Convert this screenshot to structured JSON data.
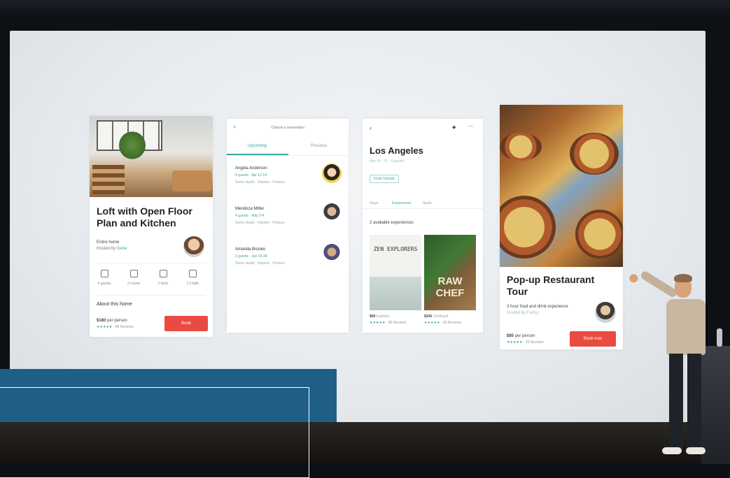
{
  "card_listing": {
    "title": "Loft with Open Floor Plan and Kitchen",
    "type": "Entire home",
    "hosted_by": "Hosted by",
    "host": "Gene",
    "amenities": [
      "4 guests",
      "2 rooms",
      "2 beds",
      "1.5 bath"
    ],
    "about": "About this home",
    "price": "$180",
    "price_unit": "per person",
    "reviews": "· 86 Reviews",
    "book_label": "Book"
  },
  "card_reservations": {
    "header": "Choose a reservation",
    "tabs": [
      "Upcoming",
      "Previous"
    ],
    "items": [
      {
        "name": "Angela Anderson",
        "detail": "4 guests · Apr 12-14",
        "sub": "Some studio · Imperia · Product"
      },
      {
        "name": "Mendoza Mitter",
        "detail": "4 guests · May 2-4",
        "sub": "Some studio · Imperia · Product"
      },
      {
        "name": "Amanda Brooke",
        "detail": "2 guests · Jun 26-28",
        "sub": "Some studio · Imperia · Product"
      }
    ]
  },
  "card_city": {
    "city": "Los Angeles",
    "dates": "Nov 14 - 21 · 4 guests",
    "pill": "Invite Friends",
    "tabs": [
      "Stays",
      "Experiences",
      "Spots"
    ],
    "count": "2 available experiences",
    "posters": [
      {
        "title": "ZEN EXPLORERS",
        "price": "$99",
        "unit": "Explorer",
        "reviews": "· 80 Reviews"
      },
      {
        "title": "RAW CHEF",
        "price": "$240",
        "unit": "Chefhood",
        "reviews": "· 42 Reviews"
      }
    ]
  },
  "card_tour": {
    "title": "Pop-up Restaurant Tour",
    "desc": "3 hour food and drink experience",
    "host": "Hosted by Fanny",
    "price": "$85",
    "price_unit": "per person",
    "reviews": "· 45 Reviews",
    "book_label": "Book now"
  },
  "stars": "★★★★★",
  "colors": {
    "accent": "#39a7a1",
    "button": "#e94a42",
    "overlay_blue": "#1f5f86"
  }
}
